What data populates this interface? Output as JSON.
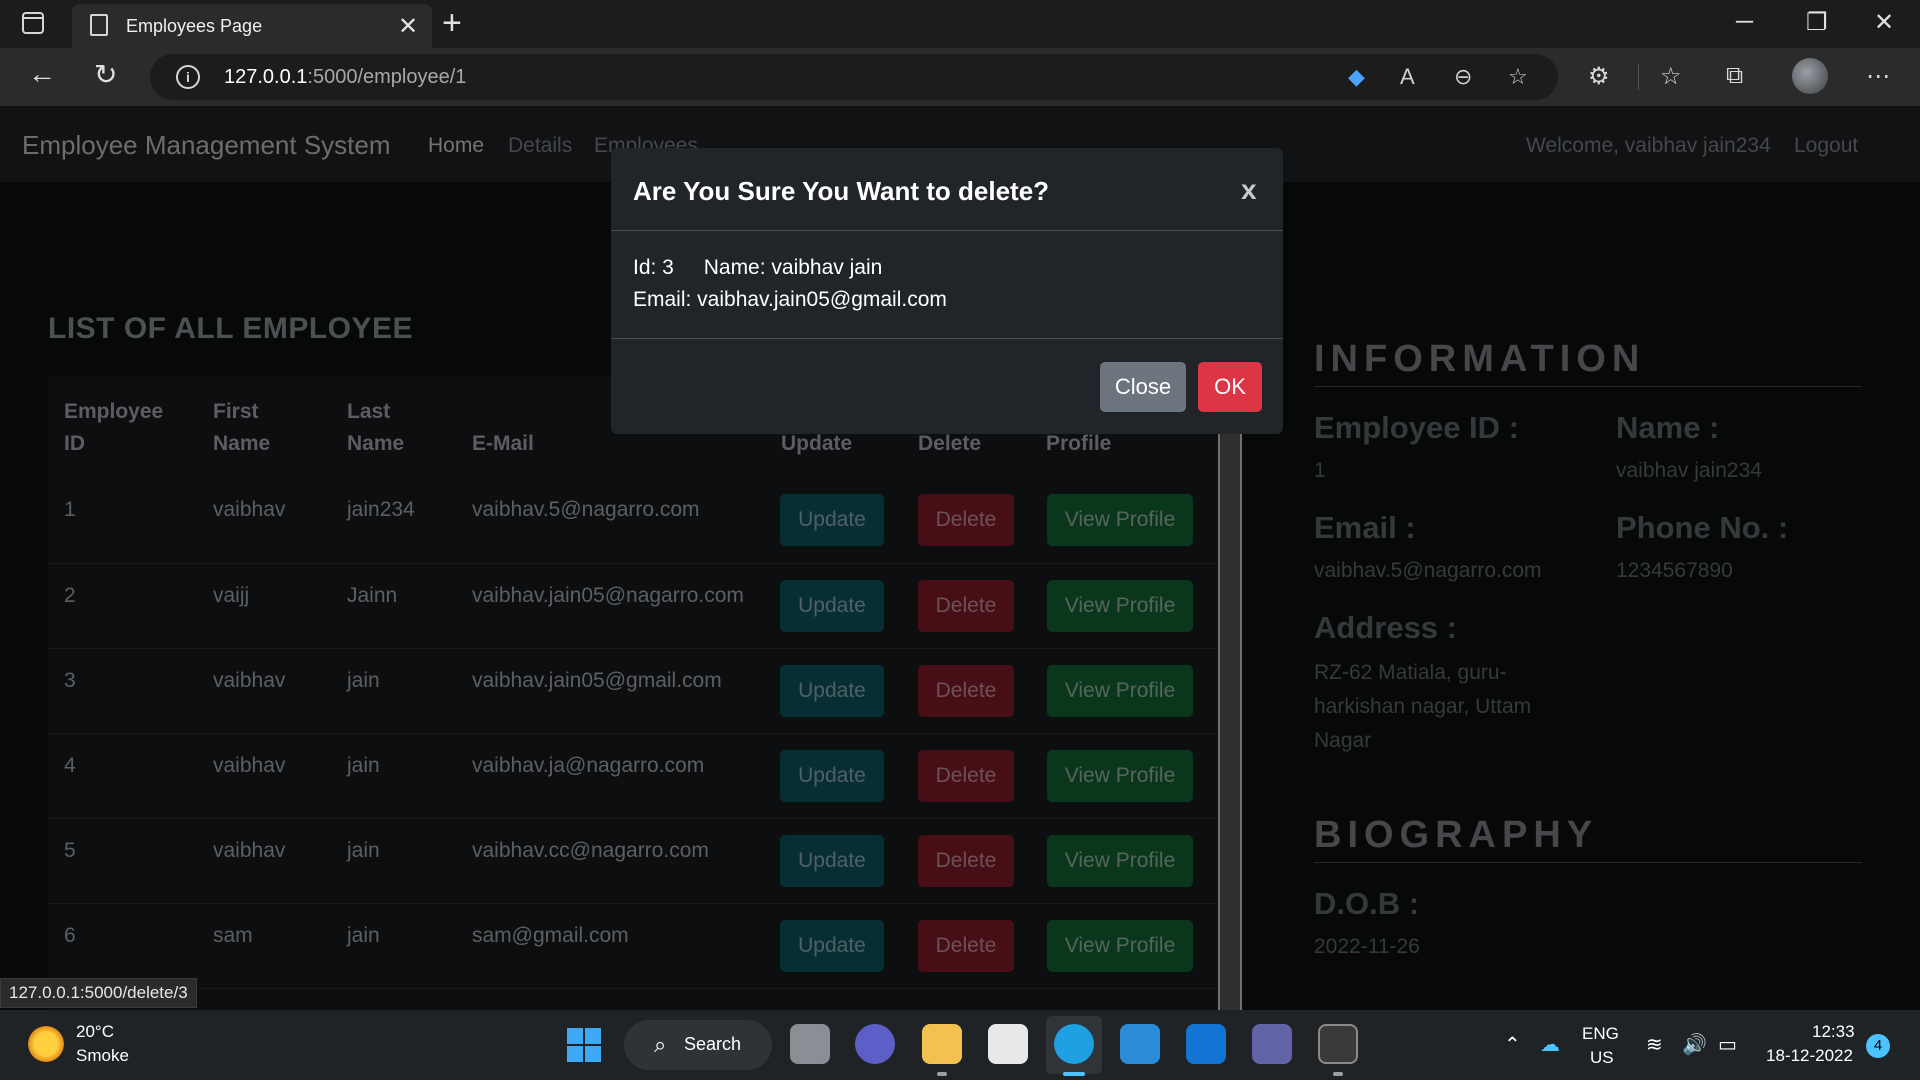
{
  "browser": {
    "tab_title": "Employees Page",
    "url_host": "127.0.0.1",
    "url_path": ":5000/employee/1",
    "status_link": "127.0.0.1:5000/delete/3"
  },
  "navbar": {
    "brand": "Employee Management System",
    "links": [
      "Home",
      "Details",
      "Employees"
    ],
    "welcome": "Welcome, vaibhav jain234",
    "logout": "Logout"
  },
  "employee_list": {
    "heading": "LIST OF ALL EMPLOYEE",
    "headers": {
      "id_line1": "Employee",
      "id_line2": "ID",
      "first_line1": "First",
      "first_line2": "Name",
      "last_line1": "Last",
      "last_line2": "Name",
      "email": "E-Mail",
      "update": "Update",
      "delete": "Delete",
      "profile": "Profile"
    },
    "rows": [
      {
        "id": "1",
        "first": "vaibhav",
        "last": "jain234",
        "email": "vaibhav.5@nagarro.com"
      },
      {
        "id": "2",
        "first": "vaijj",
        "last": "Jainn",
        "email": "vaibhav.jain05@nagarro.com"
      },
      {
        "id": "3",
        "first": "vaibhav",
        "last": "jain",
        "email": "vaibhav.jain05@gmail.com"
      },
      {
        "id": "4",
        "first": "vaibhav",
        "last": "jain",
        "email": "vaibhav.ja@nagarro.com"
      },
      {
        "id": "5",
        "first": "vaibhav",
        "last": "jain",
        "email": "vaibhav.cc@nagarro.com"
      },
      {
        "id": "6",
        "first": "sam",
        "last": "jain",
        "email": "sam@gmail.com"
      }
    ],
    "button_labels": {
      "update": "Update",
      "delete": "Delete",
      "profile": "View Profile"
    }
  },
  "information": {
    "title": "INFORMATION",
    "employee_id_label": "Employee ID :",
    "employee_id": "1",
    "name_label": "Name :",
    "name": "vaibhav jain234",
    "email_label": "Email :",
    "email": "vaibhav.5@nagarro.com",
    "phone_label": "Phone No. :",
    "phone": "1234567890",
    "address_label": "Address :",
    "address_lines": [
      "RZ-62 Matiala, guru-",
      "harkishan nagar, Uttam",
      "Nagar"
    ]
  },
  "biography": {
    "title": "BIOGRAPHY",
    "dob_label": "D.O.B :",
    "dob": "2022-11-26"
  },
  "modal": {
    "title": "Are You Sure You Want to delete?",
    "close_x": "x",
    "id_text": "Id: 3",
    "name_text": "Name: vaibhav jain",
    "email_text": "Email: vaibhav.jain05@gmail.com",
    "close_label": "Close",
    "ok_label": "OK"
  },
  "taskbar": {
    "temperature": "20°C",
    "weather": "Smoke",
    "search_label": "Search",
    "lang": "ENG",
    "region": "US",
    "time": "12:33",
    "date": "18-12-2022",
    "notification_count": "4"
  },
  "colors": {
    "update": "#0f5c6b",
    "delete": "#8f1d2b",
    "profile": "#146c37",
    "ok": "#dc3545",
    "close": "#6c757d"
  }
}
